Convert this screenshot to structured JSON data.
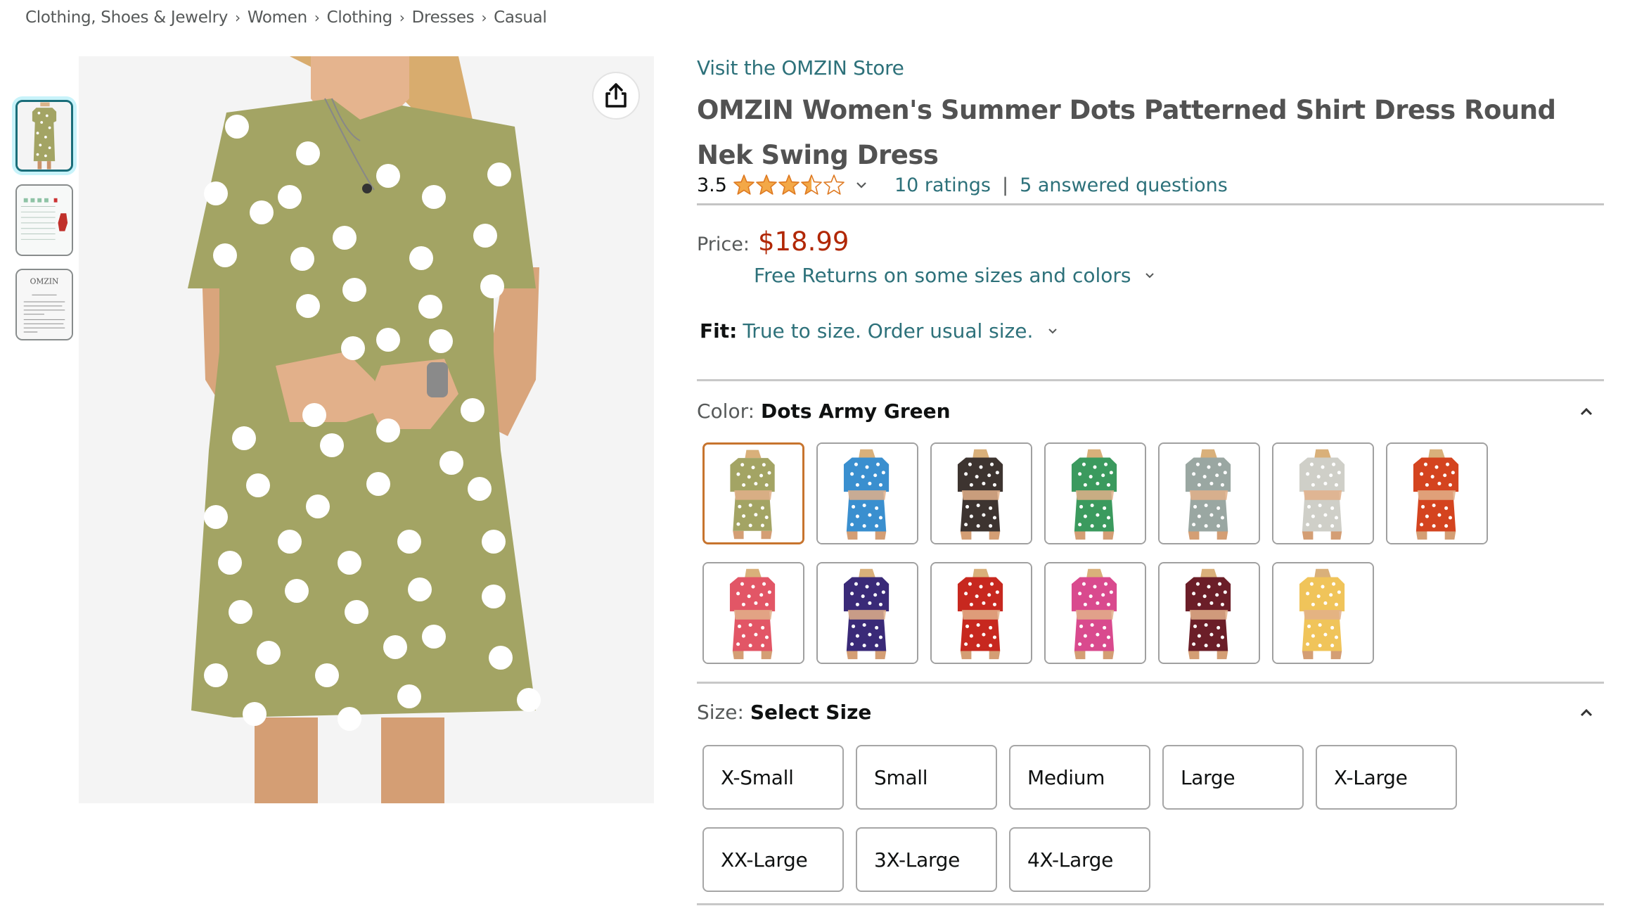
{
  "breadcrumb": [
    "Clothing, Shoes & Jewelry",
    "Women",
    "Clothing",
    "Dresses",
    "Casual"
  ],
  "breadcrumb_separator": "›",
  "thumbnails": [
    {
      "label": "Main product photo - Dots Army Green dress",
      "selected": true
    },
    {
      "label": "Size chart image",
      "selected": false
    },
    {
      "label": "OMZIN brand info image",
      "selected": false
    }
  ],
  "share_icon": "share-icon",
  "product": {
    "store_link": "Visit the OMZIN Store",
    "title": "OMZIN Women's Summer Dots Patterned Shirt Dress Round Nek Swing Dress",
    "rating": "3.5",
    "rating_value": 3.5,
    "rating_max": 5,
    "ratings_count": "10 ratings",
    "separator": "|",
    "answered_questions": "5 answered questions",
    "price_label": "Price:",
    "price": "$18.99",
    "free_returns": "Free Returns on some sizes and colors",
    "fit_label": "Fit:",
    "fit_value": "True to size. Order usual size."
  },
  "color": {
    "label": "Color:",
    "selected": "Dots Army Green",
    "options": [
      {
        "name": "Dots Army Green",
        "hex": "#a3a464",
        "selected": true
      },
      {
        "name": "Blue",
        "hex": "#3a8fcf",
        "selected": false
      },
      {
        "name": "Black",
        "hex": "#3d3430",
        "selected": false
      },
      {
        "name": "Green",
        "hex": "#3b9a5e",
        "selected": false
      },
      {
        "name": "Grey",
        "hex": "#9aa7a2",
        "selected": false
      },
      {
        "name": "Light Grey",
        "hex": "#cfcfc8",
        "selected": false
      },
      {
        "name": "Orange Red",
        "hex": "#d4441f",
        "selected": false
      },
      {
        "name": "Watermelon Red",
        "hex": "#e25666",
        "selected": false
      },
      {
        "name": "Navy Purple",
        "hex": "#3a2a78",
        "selected": false
      },
      {
        "name": "Red",
        "hex": "#c7281f",
        "selected": false
      },
      {
        "name": "Rose",
        "hex": "#d94a8e",
        "selected": false
      },
      {
        "name": "Wine Red",
        "hex": "#6b1e28",
        "selected": false
      },
      {
        "name": "Yellow",
        "hex": "#f0c45a",
        "selected": false
      }
    ]
  },
  "size": {
    "label": "Size:",
    "selected": "Select Size",
    "options": [
      "X-Small",
      "Small",
      "Medium",
      "Large",
      "X-Large",
      "XX-Large",
      "3X-Large",
      "4X-Large"
    ]
  },
  "colors": {
    "link": "#2d717a",
    "price": "#b12704",
    "star": "#f3a847",
    "selected_swatch": "#c7742e",
    "selected_thumb": "#1a6e7a",
    "main_dress": "#a3a464"
  }
}
